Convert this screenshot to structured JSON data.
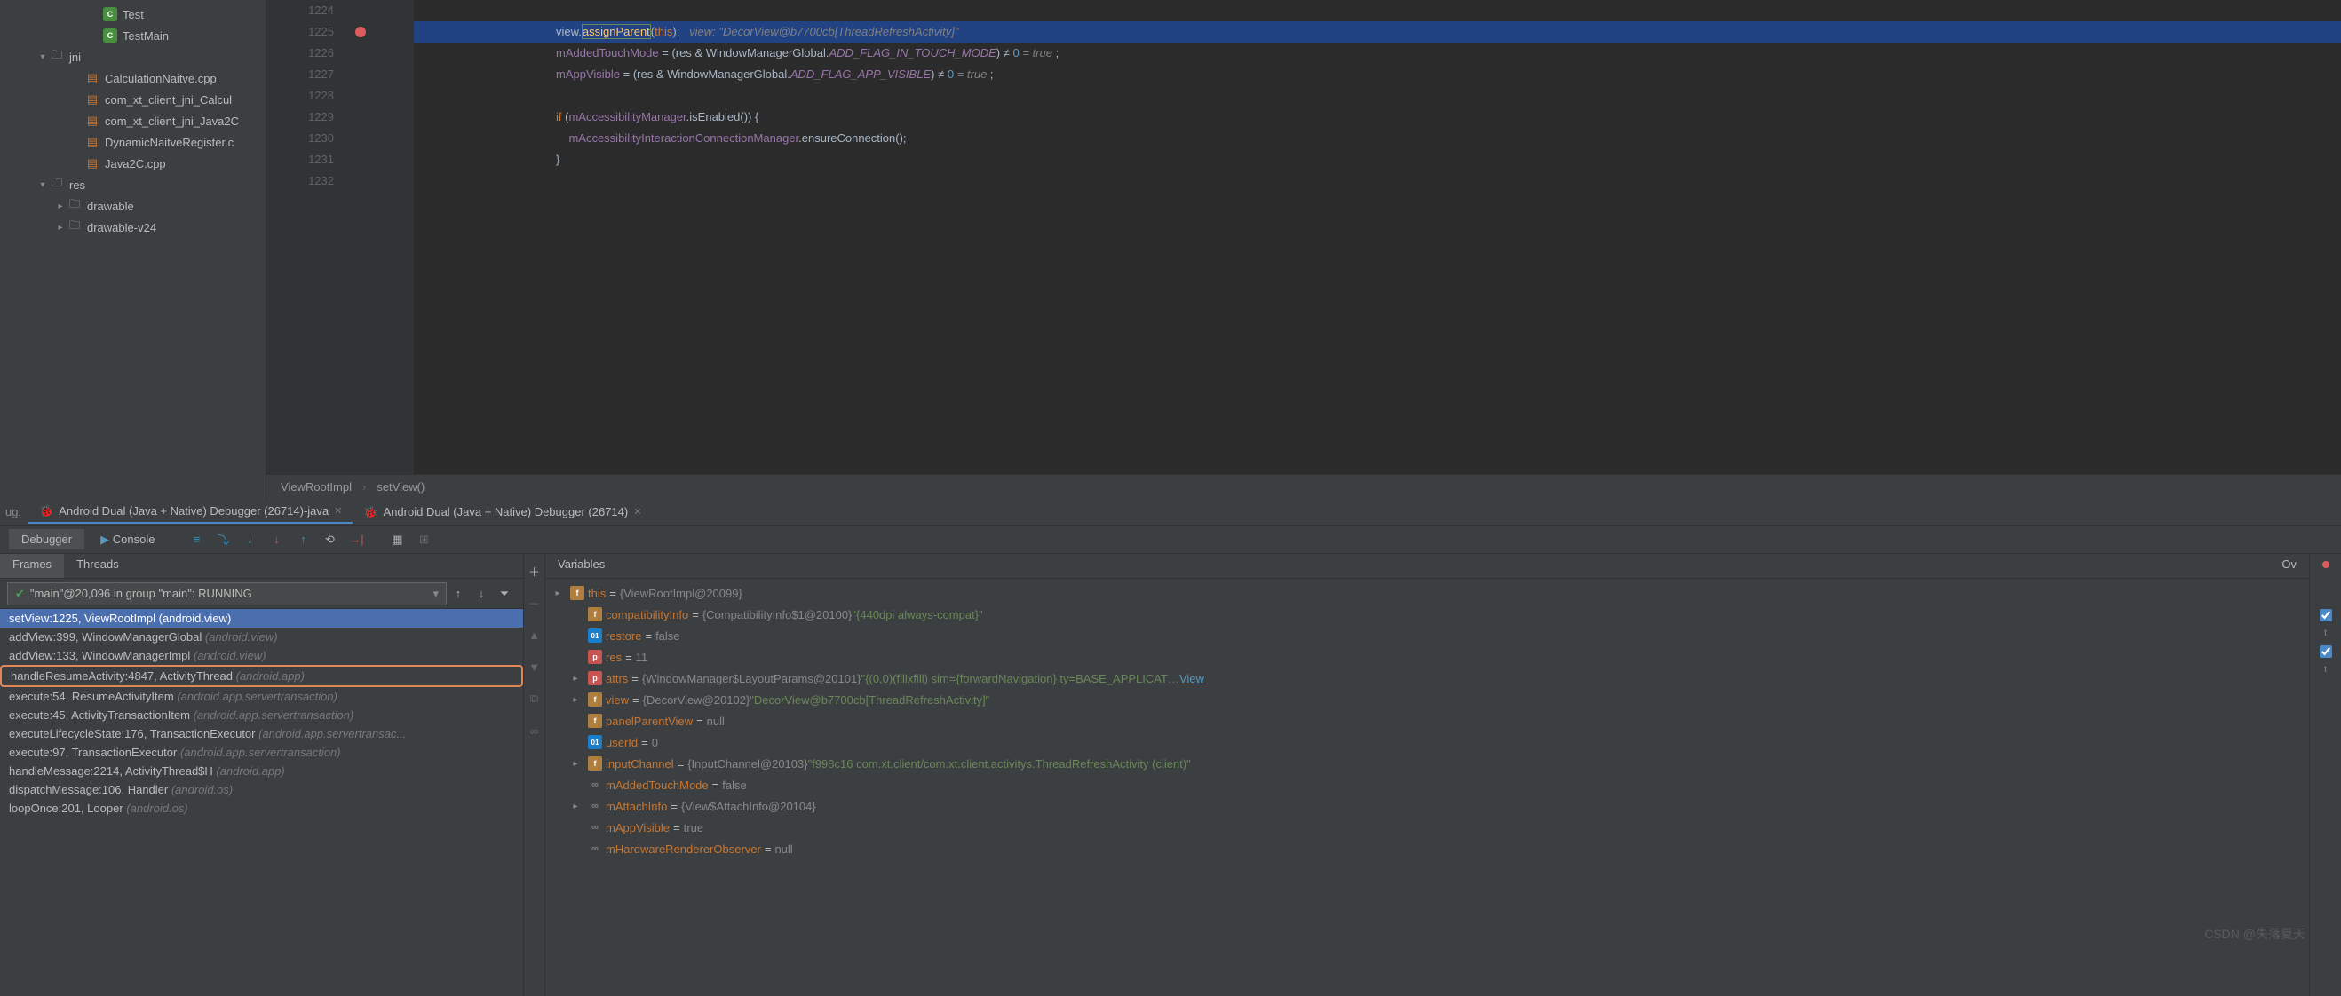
{
  "tree": {
    "items": [
      {
        "label": "Test",
        "indent": 4,
        "icon": "c"
      },
      {
        "label": "TestMain",
        "indent": 4,
        "icon": "c"
      },
      {
        "label": "jni",
        "indent": 1,
        "icon": "fold",
        "exp": true
      },
      {
        "label": "CalculationNaitve.cpp",
        "indent": 3,
        "icon": "file"
      },
      {
        "label": "com_xt_client_jni_Calcul",
        "indent": 3,
        "icon": "file"
      },
      {
        "label": "com_xt_client_jni_Java2C",
        "indent": 3,
        "icon": "file"
      },
      {
        "label": "DynamicNaitveRegister.c",
        "indent": 3,
        "icon": "file"
      },
      {
        "label": "Java2C.cpp",
        "indent": 3,
        "icon": "file"
      },
      {
        "label": "res",
        "indent": 1,
        "icon": "fold",
        "exp": true
      },
      {
        "label": "drawable",
        "indent": 2,
        "icon": "fold",
        "exp": false
      },
      {
        "label": "drawable-v24",
        "indent": 2,
        "icon": "fold",
        "exp": false
      }
    ]
  },
  "gutter": [
    "1224",
    "1225",
    "1226",
    "1227",
    "1228",
    "1229",
    "1230",
    "1231",
    "1232"
  ],
  "breadcrumb": {
    "a": "ViewRootImpl",
    "b": "setView()"
  },
  "dtabs": {
    "label": "ug:",
    "t1": "Android Dual (Java + Native) Debugger (26714)-java",
    "t2": "Android Dual (Java + Native) Debugger (26714)"
  },
  "dtoolbar": {
    "a": "Debugger",
    "b": "Console"
  },
  "ptabs": {
    "a": "Frames",
    "b": "Threads"
  },
  "thread": "\"main\"@20,096 in group \"main\": RUNNING",
  "frames": [
    {
      "fn": "setView:1225, ViewRootImpl",
      "pkg": "(android.view)",
      "sel": true
    },
    {
      "fn": "addView:399, WindowManagerGlobal",
      "pkg": "(android.view)"
    },
    {
      "fn": "addView:133, WindowManagerImpl",
      "pkg": "(android.view)"
    },
    {
      "fn": "handleResumeActivity:4847, ActivityThread",
      "pkg": "(android.app)",
      "boxed": true
    },
    {
      "fn": "execute:54, ResumeActivityItem",
      "pkg": "(android.app.servertransaction)"
    },
    {
      "fn": "execute:45, ActivityTransactionItem",
      "pkg": "(android.app.servertransaction)"
    },
    {
      "fn": "executeLifecycleState:176, TransactionExecutor",
      "pkg": "(android.app.servertransac..."
    },
    {
      "fn": "execute:97, TransactionExecutor",
      "pkg": "(android.app.servertransaction)"
    },
    {
      "fn": "handleMessage:2214, ActivityThread$H",
      "pkg": "(android.app)"
    },
    {
      "fn": "dispatchMessage:106, Handler",
      "pkg": "(android.os)"
    },
    {
      "fn": "loopOnce:201, Looper",
      "pkg": "(android.os)"
    }
  ],
  "varsHead": {
    "a": "Variables",
    "b": "Ov"
  },
  "vars": [
    {
      "exp": true,
      "icon": "f",
      "name": "this",
      "val": "{ViewRootImpl@20099}"
    },
    {
      "icon": "f",
      "name": "compatibilityInfo",
      "val": "{CompatibilityInfo$1@20100}",
      "str": "\"{440dpi always-compat}\"",
      "ind": 1
    },
    {
      "icon": "num",
      "name": "restore",
      "val": "false",
      "ind": 1
    },
    {
      "icon": "p",
      "name": "res",
      "val": "11",
      "ind": 1
    },
    {
      "exp": true,
      "icon": "p",
      "name": "attrs",
      "val": "{WindowManager$LayoutParams@20101}",
      "str": "\"{(0,0)(fillxfill) sim={forwardNavigation} ty=BASE_APPLICAT…",
      "link": "View",
      "ind": 1
    },
    {
      "exp": true,
      "icon": "f",
      "name": "view",
      "val": "{DecorView@20102}",
      "str": "\"DecorView@b7700cb[ThreadRefreshActivity]\"",
      "ind": 1
    },
    {
      "icon": "f",
      "name": "panelParentView",
      "val": "null",
      "ind": 1
    },
    {
      "icon": "num",
      "name": "userId",
      "val": "0",
      "ind": 1
    },
    {
      "exp": true,
      "icon": "f",
      "name": "inputChannel",
      "val": "{InputChannel@20103}",
      "str": "\"f998c16 com.xt.client/com.xt.client.activitys.ThreadRefreshActivity (client)\"",
      "ind": 1
    },
    {
      "icon": "oo",
      "name": "mAddedTouchMode",
      "val": "false",
      "ind": 1
    },
    {
      "exp": true,
      "icon": "oo",
      "name": "mAttachInfo",
      "val": "{View$AttachInfo@20104}",
      "ind": 1
    },
    {
      "icon": "oo",
      "name": "mAppVisible",
      "val": "true",
      "ind": 1
    },
    {
      "icon": "oo",
      "name": "mHardwareRendererObserver",
      "val": "null",
      "ind": 1
    }
  ],
  "watermark": "CSDN @失落夏天"
}
